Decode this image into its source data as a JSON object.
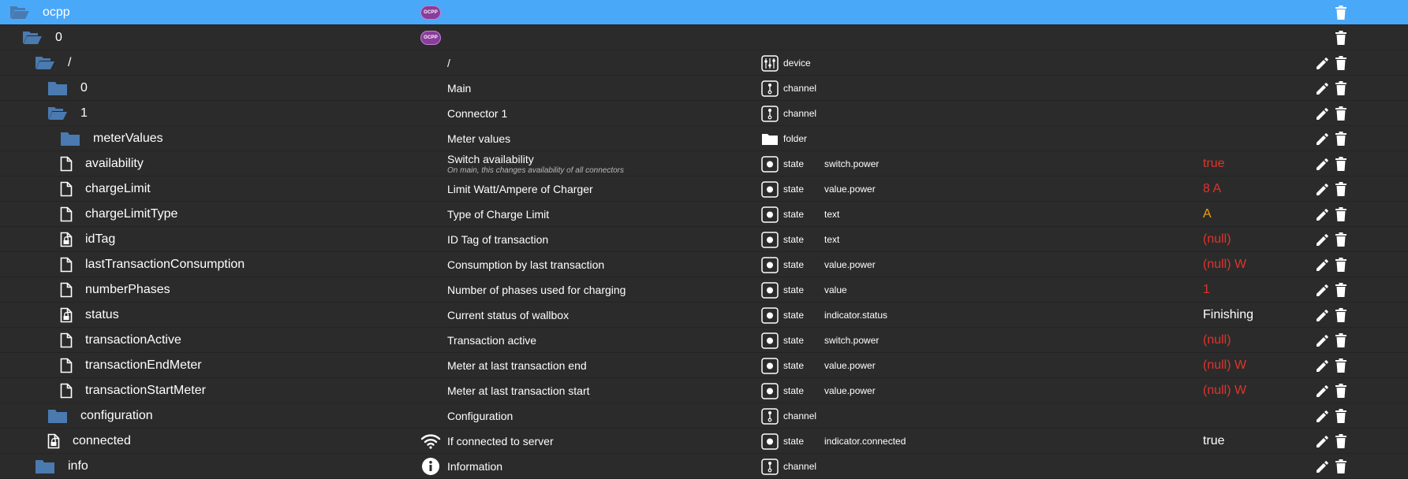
{
  "colors": {
    "selected_row": "#4aa8f8",
    "background": "#2b2b2b",
    "folder": "#4a7ab0",
    "value_red": "#e0342b",
    "value_orange": "#f0a010",
    "value_white": "#ffffff"
  },
  "rows": [
    {
      "name": "ocpp",
      "icon": "folder-open-icon",
      "desc": "",
      "desc_icon": "ocpp-logo",
      "type": "",
      "type_icon": "",
      "role": "",
      "value": "",
      "value_color": "",
      "edit": false,
      "selected": true,
      "depth": 0
    },
    {
      "name": "0",
      "icon": "folder-open-icon",
      "desc": "",
      "desc_icon": "ocpp-logo",
      "type": "",
      "type_icon": "",
      "role": "",
      "value": "",
      "value_color": "",
      "edit": false,
      "selected": false,
      "depth": 1
    },
    {
      "name": "/",
      "icon": "folder-open-icon",
      "desc": "/",
      "desc_icon": "",
      "type": "device",
      "type_icon": "device-icon",
      "role": "",
      "value": "",
      "value_color": "",
      "edit": true,
      "selected": false,
      "depth": 2
    },
    {
      "name": "0",
      "icon": "folder-closed-icon",
      "desc": "Main",
      "desc_icon": "",
      "type": "channel",
      "type_icon": "channel-icon",
      "role": "",
      "value": "",
      "value_color": "",
      "edit": true,
      "selected": false,
      "depth": 3
    },
    {
      "name": "1",
      "icon": "folder-open-icon",
      "desc": "Connector 1",
      "desc_icon": "",
      "type": "channel",
      "type_icon": "channel-icon",
      "role": "",
      "value": "",
      "value_color": "",
      "edit": true,
      "selected": false,
      "depth": 3
    },
    {
      "name": "meterValues",
      "icon": "folder-closed-icon",
      "desc": "Meter values",
      "desc_icon": "",
      "type": "folder",
      "type_icon": "folder-type-icon",
      "role": "",
      "value": "",
      "value_color": "",
      "edit": true,
      "selected": false,
      "depth": 4
    },
    {
      "name": "availability",
      "icon": "file-icon",
      "desc": "Switch availability",
      "desc_sub": "On main, this changes availability of all connectors",
      "desc_icon": "",
      "type": "state",
      "type_icon": "state-icon",
      "role": "switch.power",
      "value": "true",
      "value_color": "#e0342b",
      "edit": true,
      "selected": false,
      "depth": 4
    },
    {
      "name": "chargeLimit",
      "icon": "file-icon",
      "desc": "Limit Watt/Ampere of Charger",
      "desc_icon": "",
      "type": "state",
      "type_icon": "state-icon",
      "role": "value.power",
      "value": "8 A",
      "value_color": "#e0342b",
      "edit": true,
      "selected": false,
      "depth": 4
    },
    {
      "name": "chargeLimitType",
      "icon": "file-icon",
      "desc": "Type of Charge Limit",
      "desc_icon": "",
      "type": "state",
      "type_icon": "state-icon",
      "role": "text",
      "value": "A",
      "value_color": "#f0a010",
      "edit": true,
      "selected": false,
      "depth": 4
    },
    {
      "name": "idTag",
      "icon": "file-lock-icon",
      "desc": "ID Tag of transaction",
      "desc_icon": "",
      "type": "state",
      "type_icon": "state-icon",
      "role": "text",
      "value": "(null)",
      "value_color": "#e0342b",
      "edit": true,
      "selected": false,
      "depth": 4
    },
    {
      "name": "lastTransactionConsumption",
      "icon": "file-icon",
      "desc": "Consumption by last transaction",
      "desc_icon": "",
      "type": "state",
      "type_icon": "state-icon",
      "role": "value.power",
      "value": "(null) W",
      "value_color": "#e0342b",
      "edit": true,
      "selected": false,
      "depth": 4
    },
    {
      "name": "numberPhases",
      "icon": "file-icon",
      "desc": "Number of phases used for charging",
      "desc_icon": "",
      "type": "state",
      "type_icon": "state-icon",
      "role": "value",
      "value": "1",
      "value_color": "#e0342b",
      "edit": true,
      "selected": false,
      "depth": 4
    },
    {
      "name": "status",
      "icon": "file-lock-icon",
      "desc": "Current status of wallbox",
      "desc_icon": "",
      "type": "state",
      "type_icon": "state-icon",
      "role": "indicator.status",
      "value": "Finishing",
      "value_color": "#ffffff",
      "edit": true,
      "selected": false,
      "depth": 4
    },
    {
      "name": "transactionActive",
      "icon": "file-icon",
      "desc": "Transaction active",
      "desc_icon": "",
      "type": "state",
      "type_icon": "state-icon",
      "role": "switch.power",
      "value": "(null)",
      "value_color": "#e0342b",
      "edit": true,
      "selected": false,
      "depth": 4
    },
    {
      "name": "transactionEndMeter",
      "icon": "file-icon",
      "desc": "Meter at last transaction end",
      "desc_icon": "",
      "type": "state",
      "type_icon": "state-icon",
      "role": "value.power",
      "value": "(null) W",
      "value_color": "#e0342b",
      "edit": true,
      "selected": false,
      "depth": 4
    },
    {
      "name": "transactionStartMeter",
      "icon": "file-icon",
      "desc": "Meter at last transaction start",
      "desc_icon": "",
      "type": "state",
      "type_icon": "state-icon",
      "role": "value.power",
      "value": "(null) W",
      "value_color": "#e0342b",
      "edit": true,
      "selected": false,
      "depth": 4
    },
    {
      "name": "configuration",
      "icon": "folder-closed-icon",
      "desc": "Configuration",
      "desc_icon": "",
      "type": "channel",
      "type_icon": "channel-icon",
      "role": "",
      "value": "",
      "value_color": "",
      "edit": true,
      "selected": false,
      "depth": 3
    },
    {
      "name": "connected",
      "icon": "file-lock-icon",
      "desc": "If connected to server",
      "desc_icon": "wifi-icon",
      "type": "state",
      "type_icon": "state-icon",
      "role": "indicator.connected",
      "value": "true",
      "value_color": "#ffffff",
      "edit": true,
      "selected": false,
      "depth": 3
    },
    {
      "name": "info",
      "icon": "folder-closed-icon",
      "desc": "Information",
      "desc_icon": "info-icon",
      "type": "channel",
      "type_icon": "channel-icon",
      "role": "",
      "value": "",
      "value_color": "",
      "edit": true,
      "selected": false,
      "depth": 2
    }
  ]
}
